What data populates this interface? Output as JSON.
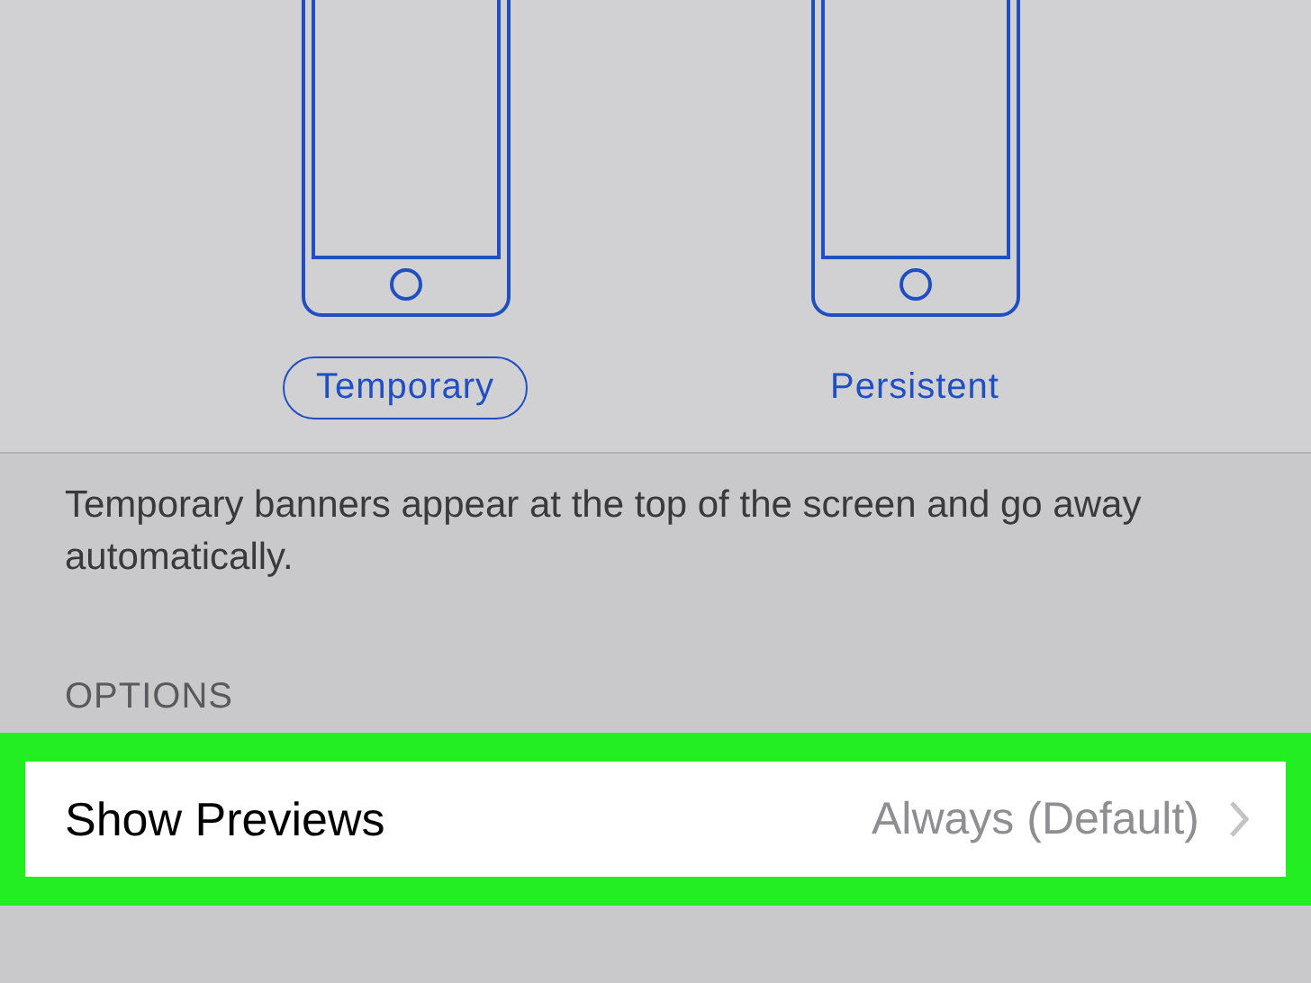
{
  "banner_styles": [
    {
      "label": "Temporary",
      "selected": true
    },
    {
      "label": "Persistent",
      "selected": false
    }
  ],
  "description": "Temporary banners appear at the top of the screen and go away automatically.",
  "section_header": "OPTIONS",
  "rows": [
    {
      "label": "Show Previews",
      "value": "Always (Default)",
      "highlighted": true
    }
  ]
}
